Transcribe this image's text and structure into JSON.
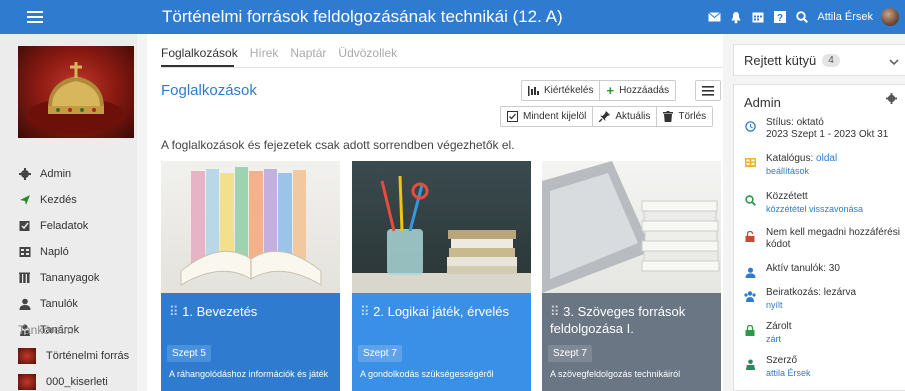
{
  "header": {
    "title": "Történelmi források feldolgozásának technikái (12. A)",
    "user_name": "Attila Érsek"
  },
  "sidebar": {
    "nav": [
      {
        "label": "Admin",
        "icon": "gear-icon"
      },
      {
        "label": "Kezdés",
        "icon": "send-icon"
      },
      {
        "label": "Feladatok",
        "icon": "edit-icon"
      },
      {
        "label": "Napló",
        "icon": "gradebook-icon"
      },
      {
        "label": "Tananyagok",
        "icon": "library-icon"
      },
      {
        "label": "Tanulók",
        "icon": "user-icon"
      },
      {
        "label": "Tanárok",
        "icon": "teacher-icon"
      }
    ],
    "section_title": "Tanköreim",
    "courses": [
      {
        "label": "Történelmi forrás"
      },
      {
        "label": "000_kiserleti"
      }
    ]
  },
  "tabs": [
    {
      "label": "Foglalkozások"
    },
    {
      "label": "Hírek"
    },
    {
      "label": "Naptár"
    },
    {
      "label": "Üdvözollek"
    }
  ],
  "main": {
    "section_title": "Foglalkozások",
    "buttons": {
      "evaluate": "Kiértékelés",
      "add": "Hozzáadás",
      "select_all": "Mindent kijelöl",
      "current": "Aktuális",
      "delete": "Törlés"
    },
    "notice": "A foglalkozások és fejezetek csak adott sorrendben végezhetők el.",
    "cards": [
      {
        "title": "1. Bevezetés",
        "date": "Szept 5",
        "desc": "A ráhangolódáshoz információk és játék"
      },
      {
        "title": "2. Logikai játék, érvelés",
        "date": "Szept 7",
        "desc": "A gondolkodás szükségességéről"
      },
      {
        "title": "3. Szöveges források feldolgozása I.",
        "date": "Szept 7",
        "desc": "A szövegfeldolgozás technikáiról"
      }
    ]
  },
  "right": {
    "hidden_label": "Rejtett kütyü",
    "hidden_count": "4",
    "admin_title": "Admin",
    "rows": {
      "style_line": "Stílus: oktató",
      "style_dates": "2023 Szept 1 - 2023 Okt 31",
      "catalog_prefix": "Katalógus:",
      "catalog_value": "oldal",
      "catalog_sub": "beállítások",
      "published": "Közzétett",
      "published_sub": "közzététel visszavonása",
      "access": "Nem kell megadni hozzáférési kódot",
      "active": "Aktív tanulók: 30",
      "enroll": "Beiratkozás: lezárva",
      "enroll_sub": "nyílt",
      "closed": "Zárolt",
      "closed_sub": "zárt",
      "author": "Szerző",
      "author_sub": "attila Érsek"
    }
  },
  "colors": {
    "primary": "#2e7bcf",
    "card1": "#2e7bcf",
    "card2": "#3a8fe6",
    "card3": "#6b7684"
  }
}
